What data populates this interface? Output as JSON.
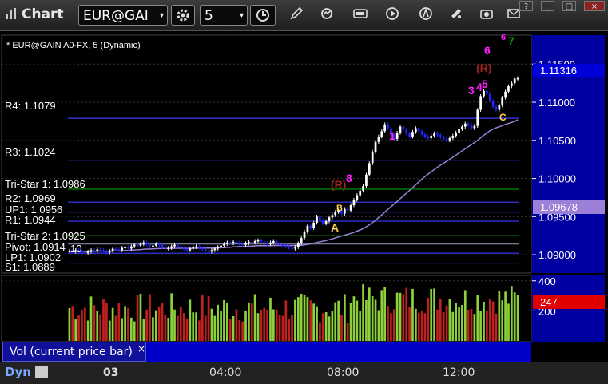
{
  "window": {
    "title": "Chart",
    "help_btn": "?",
    "min_btn": "_",
    "max_btn": "□",
    "close_btn": "×"
  },
  "toolbar": {
    "symbol": "EUR@GAI",
    "interval": "5",
    "icons": [
      "chart-icon",
      "settings-icon",
      "clock-icon",
      "pencil-icon",
      "refresh-icon",
      "quote-icon",
      "play-icon",
      "alert-icon",
      "link-icon",
      "camera-icon",
      "mail-icon"
    ]
  },
  "header": {
    "title": "* EUR@GAIN A0-FX, 5 (Dynamic)"
  },
  "colors": {
    "up_bar": "#ffffff",
    "down_bar": "#2222ff",
    "level_line": "#3a3aff",
    "green_level": "#00a000",
    "background": "#000000",
    "panel_bg": "#0000a0",
    "price_tag": "#0000d8",
    "avg_tag": "#9b7fd8",
    "vol_tag": "#e00000"
  },
  "labels": {
    "r4": "R4: 1.1079",
    "r3": "R3: 1.1024",
    "tristar1": "Tri-Star 1: 1.0986",
    "r2": "R2: 1.0969",
    "up1": "UP1: 1.0956",
    "r1": "R1: 1.0944",
    "tristar2": "Tri-Star 2: 1.0925",
    "pivot": "Pivot: 1.0914",
    "p10": "10",
    "lp1": "LP1: 1.0902",
    "s1": "S1: 1.0889",
    "price_tag": "1.11316",
    "avg_tag": "1.09678",
    "vol_tag": "247",
    "vol_panel": "Vol (current price bar)",
    "close_x": "×",
    "dyn": "Dyn",
    "mark_A": "A",
    "mark_B": "B",
    "mark_C": "C",
    "r_mark1": "(R)",
    "r_mark2": "(R)",
    "mark_1": "1",
    "mark_8": "8",
    "mark_6": "6",
    "mark_3": "3",
    "mark_4": "4",
    "mark_5": "5",
    "mark_6b": "6",
    "mark_7": "7"
  },
  "chart_data": [
    {
      "type": "candlestick",
      "title": "* EUR@GAIN A0-FX, 5 (Dynamic)",
      "yticks": [
        1.09,
        1.095,
        1.1,
        1.105,
        1.11,
        1.115
      ],
      "ylim": [
        1.0876,
        1.1188
      ],
      "xticks": [
        "03",
        "04:00",
        "08:00",
        "12:00"
      ],
      "levels": [
        {
          "name": "R4",
          "value": 1.1079
        },
        {
          "name": "R3",
          "value": 1.1024
        },
        {
          "name": "Tri-Star 1",
          "value": 1.0986
        },
        {
          "name": "R2",
          "value": 1.0969
        },
        {
          "name": "UP1",
          "value": 1.0956
        },
        {
          "name": "R1",
          "value": 1.0944
        },
        {
          "name": "Tri-Star 2",
          "value": 1.0925
        },
        {
          "name": "Pivot",
          "value": 1.0914
        },
        {
          "name": "LP1",
          "value": 1.0902
        },
        {
          "name": "S1",
          "value": 1.0889
        }
      ],
      "last_price": 1.11316,
      "moving_average_last": 1.09678,
      "close_series": [
        1.0905,
        1.0904,
        1.0906,
        1.0905,
        1.0903,
        1.0902,
        1.0904,
        1.0906,
        1.0905,
        1.0907,
        1.0906,
        1.0904,
        1.0903,
        1.0905,
        1.0908,
        1.0907,
        1.0906,
        1.0909,
        1.091,
        1.0908,
        1.0911,
        1.0913,
        1.0912,
        1.0914,
        1.0916,
        1.0913,
        1.0911,
        1.0912,
        1.0914,
        1.0913,
        1.091,
        1.0908,
        1.0909,
        1.0911,
        1.0913,
        1.0911,
        1.0909,
        1.0907,
        1.0906,
        1.0908,
        1.091,
        1.0911,
        1.0909,
        1.0907,
        1.0905,
        1.0904,
        1.0906,
        1.0908,
        1.091,
        1.0912,
        1.0914,
        1.0916,
        1.0915,
        1.0917,
        1.0916,
        1.0914,
        1.0913,
        1.0915,
        1.0917,
        1.0916,
        1.0918,
        1.0919,
        1.0917,
        1.0915,
        1.0914,
        1.0916,
        1.0918,
        1.0915,
        1.0913,
        1.0912,
        1.0911,
        1.0909,
        1.0908,
        1.091,
        1.0915,
        1.0922,
        1.093,
        1.0938,
        1.0935,
        1.0942,
        1.095,
        1.0946,
        1.0941,
        1.0944,
        1.0949,
        1.0952,
        1.0956,
        1.0958,
        1.0954,
        1.096,
        1.0958,
        1.0965,
        1.0972,
        1.0978,
        1.0984,
        1.099,
        1.1005,
        1.102,
        1.1035,
        1.1048,
        1.1055,
        1.1062,
        1.1071,
        1.1066,
        1.1058,
        1.1052,
        1.106,
        1.1068,
        1.1064,
        1.1059,
        1.1055,
        1.1061,
        1.1066,
        1.1062,
        1.1058,
        1.1055,
        1.1053,
        1.1056,
        1.1059,
        1.1057,
        1.1054,
        1.1052,
        1.105,
        1.1053,
        1.1056,
        1.106,
        1.1065,
        1.1068,
        1.1072,
        1.107,
        1.1066,
        1.1069,
        1.109,
        1.1108,
        1.1115,
        1.1111,
        1.1102,
        1.1094,
        1.109,
        1.1096,
        1.1106,
        1.1114,
        1.1121,
        1.1125,
        1.1131,
        1.11316
      ]
    },
    {
      "type": "bar",
      "title": "Vol (current price bar)",
      "yticks": [
        200,
        400
      ],
      "ylim": [
        0,
        420
      ],
      "last_value": 247,
      "values_seed": "volume"
    }
  ]
}
